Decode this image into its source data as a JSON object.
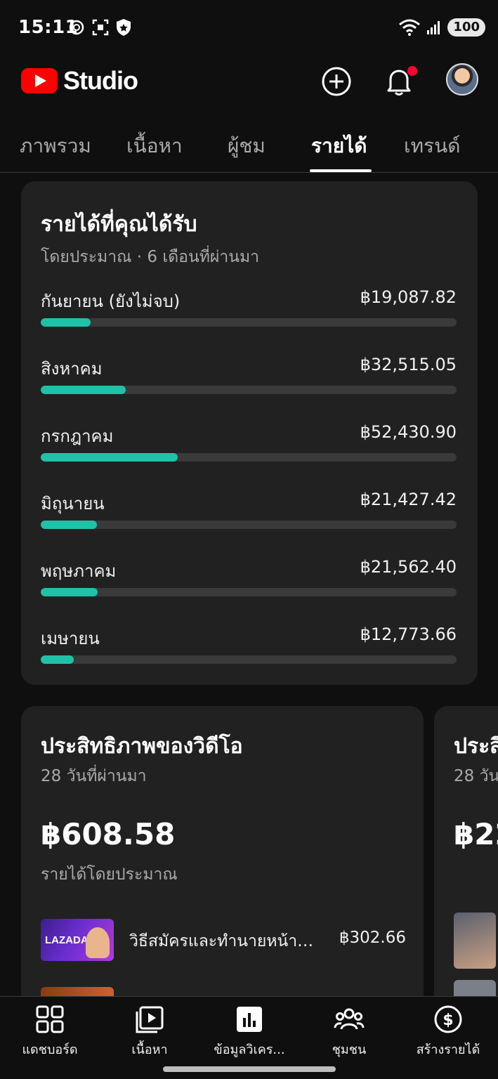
{
  "status_bar": {
    "time": "15:11",
    "battery": "100",
    "icons_left": [
      "openai-icon",
      "screenshot-icon",
      "shield-icon"
    ],
    "icons_right": [
      "wifi-icon",
      "signal-icon"
    ]
  },
  "header": {
    "logo_text": "Studio",
    "brand_color": "#ff0000",
    "notification_badge_color": "#ff0033"
  },
  "tabs": [
    {
      "label": "ภาพรวม",
      "active": false
    },
    {
      "label": "เนื้อหา",
      "active": false
    },
    {
      "label": "ผู้ชม",
      "active": false
    },
    {
      "label": "รายได้",
      "active": true
    },
    {
      "label": "เทรนด์",
      "active": false
    }
  ],
  "revenue_card": {
    "title": "รายได้ที่คุณได้รับ",
    "subtitle": "โดยประมาณ · 6 เดือนที่ผ่านมา",
    "bar_color": "#1fc2a7",
    "months": [
      {
        "month": "กันยายน (ยังไม่จบ)",
        "amount": "฿19,087.82",
        "bar_fraction": 0.12
      },
      {
        "month": "สิงหาคม",
        "amount": "฿32,515.05",
        "bar_fraction": 0.205
      },
      {
        "month": "กรกฎาคม",
        "amount": "฿52,430.90",
        "bar_fraction": 0.33
      },
      {
        "month": "มิถุนายน",
        "amount": "฿21,427.42",
        "bar_fraction": 0.135
      },
      {
        "month": "พฤษภาคม",
        "amount": "฿21,562.40",
        "bar_fraction": 0.137
      },
      {
        "month": "เมษายน",
        "amount": "฿12,773.66",
        "bar_fraction": 0.08
      }
    ]
  },
  "video_card": {
    "title": "ประสิทธิภาพของวิดีโอ",
    "subtitle": "28 วันที่ผ่านมา",
    "value": "฿608.58",
    "value_label": "รายได้โดยประมาณ",
    "videos": [
      {
        "title": "วิธีสมัครและทำนายหน้าที่...",
        "amount": "฿302.66",
        "thumb_text": "LAZADA"
      }
    ]
  },
  "peek_card": {
    "title": "ประสิ",
    "subtitle": "28 วัน",
    "value": "฿22"
  },
  "bottom_nav": [
    {
      "label": "แดชบอร์ด",
      "icon": "dashboard-icon"
    },
    {
      "label": "เนื้อหา",
      "icon": "content-icon"
    },
    {
      "label": "ข้อมูลวิเคร...",
      "icon": "analytics-icon"
    },
    {
      "label": "ชุมชน",
      "icon": "community-icon"
    },
    {
      "label": "สร้างรายได้",
      "icon": "earn-icon"
    }
  ]
}
